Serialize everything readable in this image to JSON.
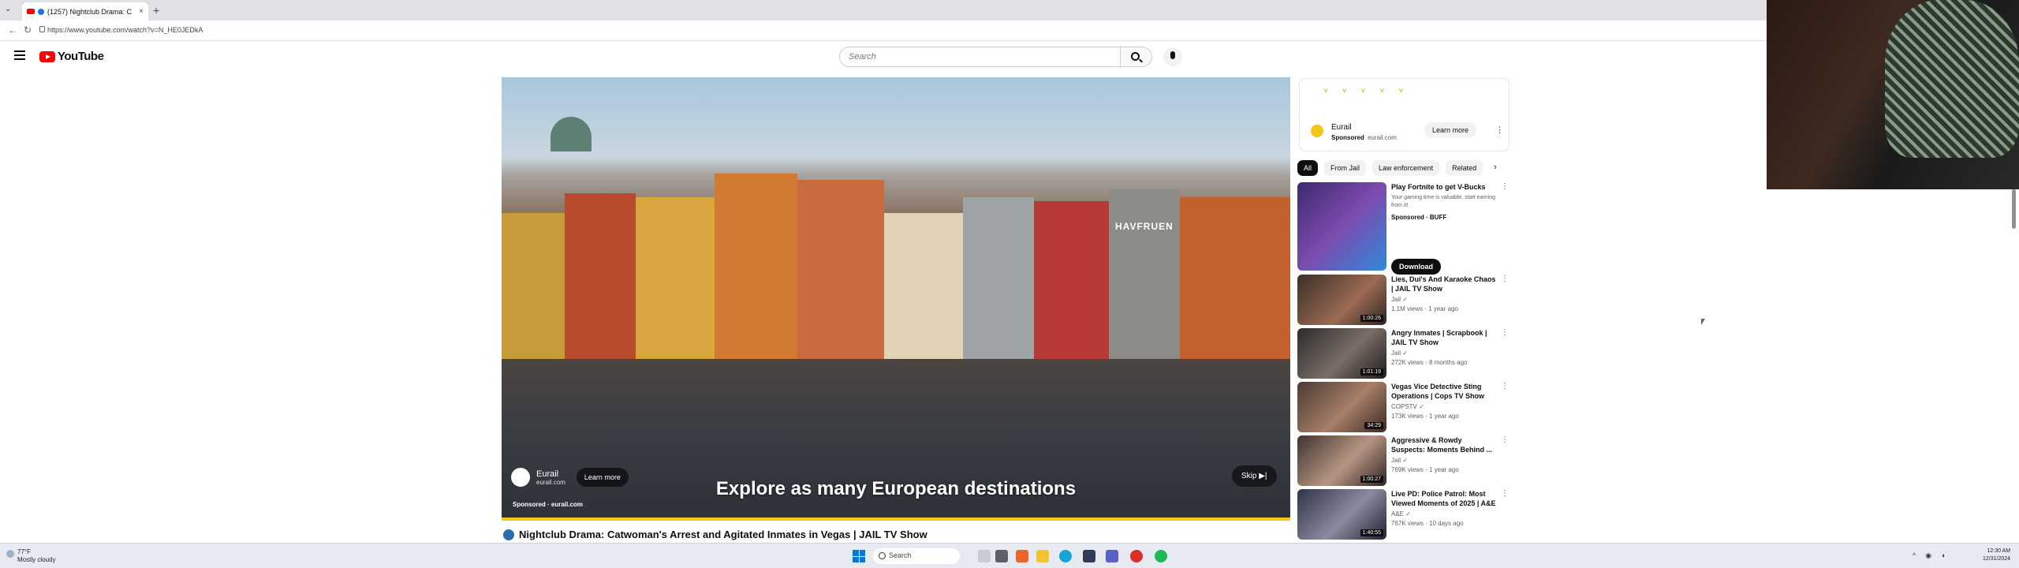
{
  "browser": {
    "tab_title": "(1257) Nightclub Drama: C",
    "new_tab": "+",
    "url": "https://www.youtube.com/watch?v=N_HE0JEDkA"
  },
  "header": {
    "logo_text": "YouTube",
    "search_placeholder": "Search"
  },
  "player": {
    "overlay_text": "Explore as many European destinations",
    "ad_name": "Eurail",
    "ad_domain": "eurail.com",
    "learn_more": "Learn more",
    "sponsored": "Sponsored · eurail.com",
    "skip": "Skip ▶|",
    "shop_sign": "HAVFRUEN"
  },
  "video": {
    "title": "Nightclub Drama: Catwoman's Arrest and Agitated Inmates in Vegas | JAIL TV Show"
  },
  "side_ad": {
    "name": "Eurail",
    "sponsored": "Sponsored",
    "domain": "eurail.com",
    "learn_more": "Learn more"
  },
  "chips": [
    "All",
    "From Jail",
    "Law enforcement",
    "Related"
  ],
  "recommendations": [
    {
      "title": "Play Fortnite to get V-Bucks",
      "channel": "Your gaming time is valuable, start earning from it!",
      "meta": "Sponsored · BUFF",
      "action": "Download",
      "duration": ""
    },
    {
      "title": "Lies, Dui's And Karaoke Chaos | JAIL TV Show",
      "channel": "Jail ✓",
      "meta": "1.1M views · 1 year ago",
      "duration": "1:00:26"
    },
    {
      "title": "Angry Inmates | Scrapbook | JAIL TV Show",
      "channel": "Jail ✓",
      "meta": "272K views · 8 months ago",
      "duration": "1:01:19"
    },
    {
      "title": "Vegas Vice Detective Sting Operations | Cops TV Show",
      "channel": "COPSTV ✓",
      "meta": "173K views · 1 year ago",
      "duration": "34:29"
    },
    {
      "title": "Aggressive & Rowdy Suspects: Moments Behind ...",
      "channel": "Jail ✓",
      "meta": "769K views · 1 year ago",
      "duration": "1:00:27"
    },
    {
      "title": "Live PD: Police Patrol: Most Viewed Moments of 2025 | A&E",
      "channel": "A&E ✓",
      "meta": "767K views · 10 days ago",
      "duration": "1:40:55"
    }
  ],
  "taskbar": {
    "weather_temp": "77°F",
    "weather_desc": "Mostly cloudy",
    "search": "Search",
    "time": "12:30 AM",
    "date": "12/31/2024"
  },
  "colors": {
    "youtube_red": "#ff0000",
    "progress_yellow": "#f5c518",
    "windows_blue": "#0078d4"
  }
}
